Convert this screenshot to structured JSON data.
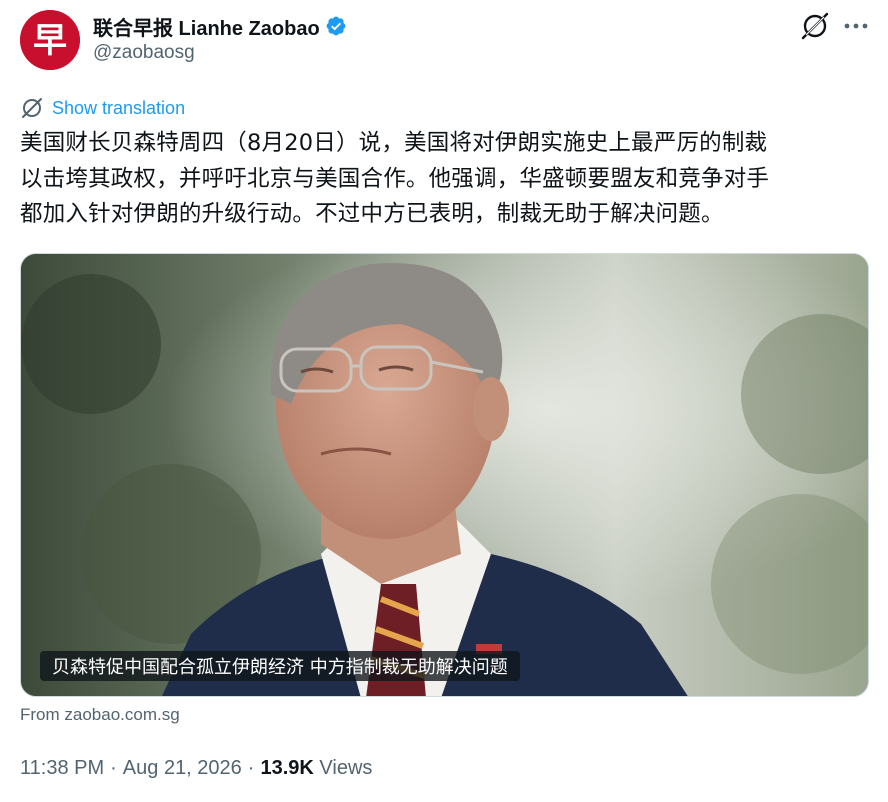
{
  "author": {
    "display_name": "联合早报 Lianhe Zaobao",
    "handle": "@zaobaosg",
    "avatar_glyph": "早",
    "avatar_color": "#c8102e",
    "verified": true,
    "verified_color": "#1d9bf0"
  },
  "actions": {
    "grok_icon": "grok-icon",
    "more_icon": "more-horizontal-icon"
  },
  "translation": {
    "label": "Show translation",
    "icon": "translate-icon",
    "color": "#1d9bf0"
  },
  "tweet": {
    "lines": [
      "美国财长贝森特周四（8月20日）说，美国将对伊朗实施史上最严厉的制裁",
      "以击垮其政权，并呼吁北京与美国合作。他强调，华盛顿要盟友和竞争对手",
      "都加入针对伊朗的升级行动。不过中方已表明，制裁无助于解决问题。"
    ]
  },
  "media": {
    "caption": "贝森特促中国配合孤立伊朗经济 中方指制裁无助解决问题"
  },
  "link_source": "From zaobao.com.sg",
  "meta": {
    "time": "11:38 PM",
    "date": "Aug 21, 2026",
    "views_count": "13.9K",
    "views_label": "Views",
    "separator": "·"
  }
}
